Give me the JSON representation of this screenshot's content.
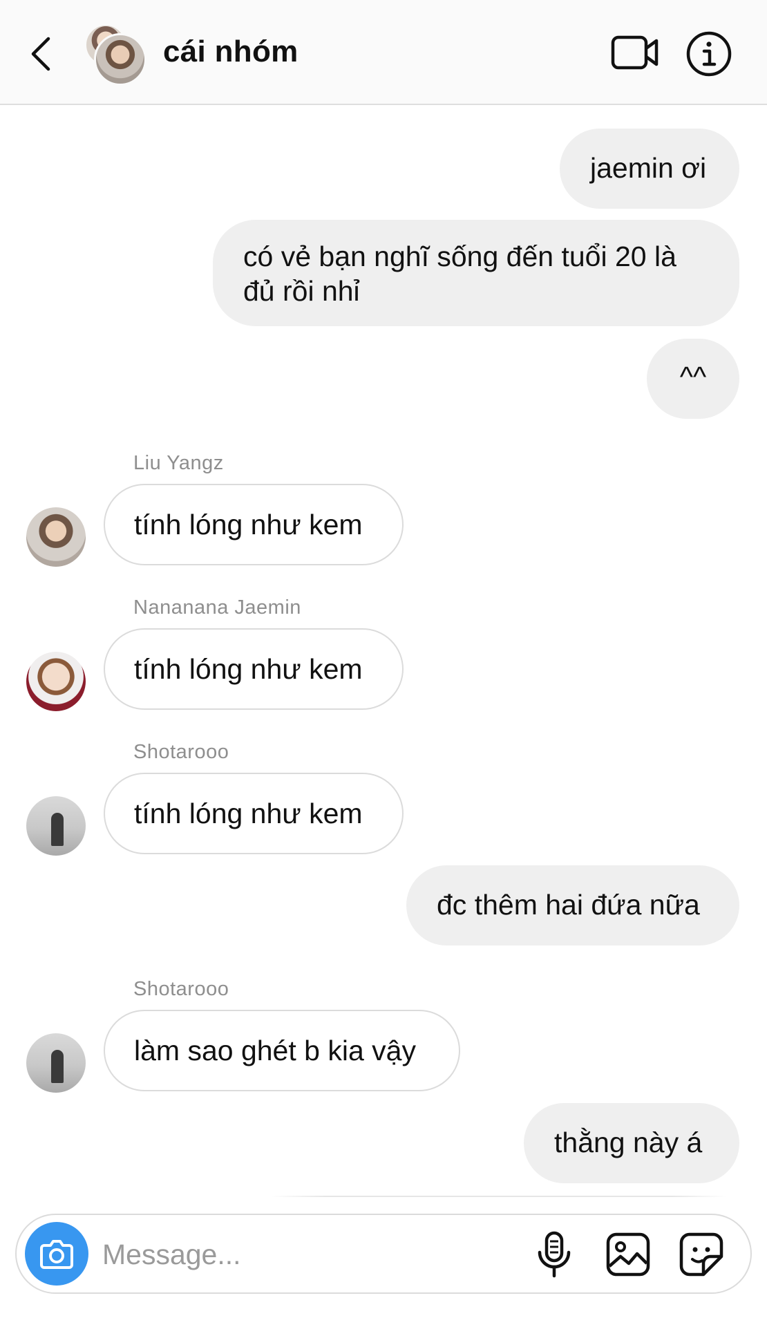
{
  "header": {
    "title": "cái nhóm",
    "back_icon": "chevron-left-icon",
    "video_icon": "video-camera-icon",
    "info_icon": "info-icon"
  },
  "messages": [
    {
      "direction": "outgoing",
      "text": "jaemin ơi"
    },
    {
      "direction": "outgoing",
      "text": "có vẻ bạn nghĩ sống đến tuổi 20 là đủ rồi nhỉ"
    },
    {
      "direction": "outgoing",
      "text": "^^"
    },
    {
      "direction": "incoming",
      "sender": "Liu Yangz",
      "text": "tính lóng như kem"
    },
    {
      "direction": "incoming",
      "sender": "Nananana Jaemin",
      "text": "tính lóng như kem"
    },
    {
      "direction": "incoming",
      "sender": "Shotarooo",
      "text": "tính lóng như kem"
    },
    {
      "direction": "outgoing",
      "text": "đc thêm hai đứa nữa"
    },
    {
      "direction": "incoming",
      "sender": "Shotarooo",
      "text": "làm sao ghét b kia vậy"
    },
    {
      "direction": "outgoing",
      "text": "thằng này á"
    }
  ],
  "composer": {
    "placeholder": "Message...",
    "camera_icon": "camera-icon",
    "mic_icon": "microphone-icon",
    "gallery_icon": "gallery-icon",
    "sticker_icon": "sticker-icon"
  },
  "colors": {
    "accent": "#3897f0",
    "outgoing_bubble": "#efefef",
    "incoming_border": "#dbdbdb",
    "secondary_text": "#8e8e8e"
  }
}
